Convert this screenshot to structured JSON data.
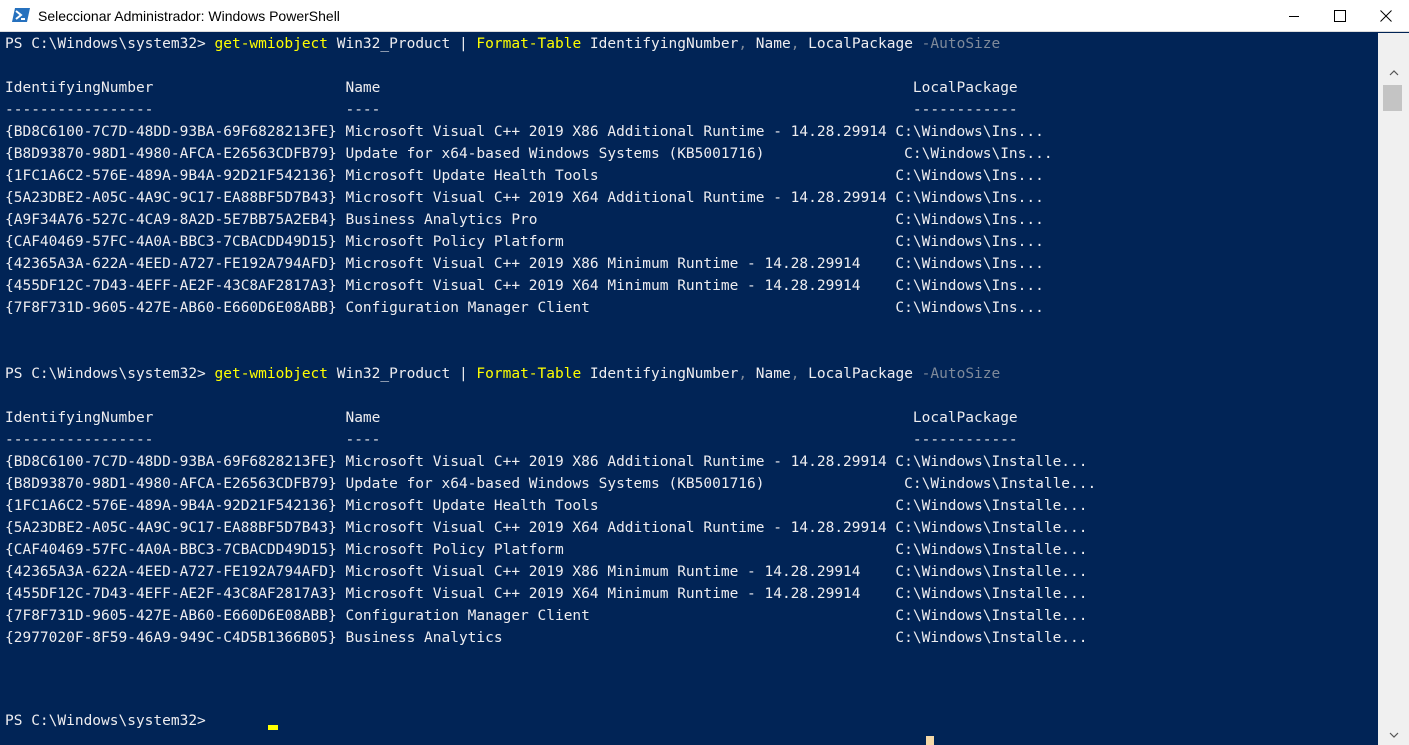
{
  "window": {
    "title": "Seleccionar Administrador: Windows PowerShell",
    "app_icon": "powershell-icon",
    "controls": {
      "minimize": "minimize-icon",
      "maximize": "maximize-icon",
      "close": "close-icon"
    }
  },
  "colors": {
    "console_background": "#012456",
    "console_text": "#EEEDF0",
    "command_highlight": "#FFFF00",
    "parameter_text": "#7F8A9A"
  },
  "console": {
    "cmd1": {
      "prompt": "PS C:\\Windows\\system32> ",
      "cmdlet": "get-wmiobject",
      "arg1": " Win32_Product | ",
      "cmdlet2": "Format-Table",
      "args": " IdentifyingNumber",
      "sep1": ",",
      "arg3": " Name",
      "sep2": ",",
      "arg4": " LocalPackage ",
      "param": "-AutoSize"
    },
    "table1": {
      "header": "IdentifyingNumber                      Name                                                             LocalPackage",
      "underline": "-----------------                      ----                                                             ------------",
      "rows": [
        "{BD8C6100-7C7D-48DD-93BA-69F6828213FE} Microsoft Visual C++ 2019 X86 Additional Runtime - 14.28.29914 C:\\Windows\\Ins...",
        "{B8D93870-98D1-4980-AFCA-E26563CDFB79} Update for x64-based Windows Systems (KB5001716)                C:\\Windows\\Ins...",
        "{1FC1A6C2-576E-489A-9B4A-92D21F542136} Microsoft Update Health Tools                                  C:\\Windows\\Ins...",
        "{5A23DBE2-A05C-4A9C-9C17-EA88BF5D7B43} Microsoft Visual C++ 2019 X64 Additional Runtime - 14.28.29914 C:\\Windows\\Ins...",
        "{A9F34A76-527C-4CA9-8A2D-5E7BB75A2EB4} Business Analytics Pro                                         C:\\Windows\\Ins...",
        "{CAF40469-57FC-4A0A-BBC3-7CBACDD49D15} Microsoft Policy Platform                                      C:\\Windows\\Ins...",
        "{42365A3A-622A-4EED-A727-FE192A794AFD} Microsoft Visual C++ 2019 X86 Minimum Runtime - 14.28.29914    C:\\Windows\\Ins...",
        "{455DF12C-7D43-4EFF-AE2F-43C8AF2817A3} Microsoft Visual C++ 2019 X64 Minimum Runtime - 14.28.29914    C:\\Windows\\Ins...",
        "{7F8F731D-9605-427E-AB60-E660D6E08ABB} Configuration Manager Client                                   C:\\Windows\\Ins..."
      ]
    },
    "table2": {
      "header": "IdentifyingNumber                      Name                                                             LocalPackage",
      "underline": "-----------------                      ----                                                             ------------",
      "rows": [
        "{BD8C6100-7C7D-48DD-93BA-69F6828213FE} Microsoft Visual C++ 2019 X86 Additional Runtime - 14.28.29914 C:\\Windows\\Installe...",
        "{B8D93870-98D1-4980-AFCA-E26563CDFB79} Update for x64-based Windows Systems (KB5001716)                C:\\Windows\\Installe...",
        "{1FC1A6C2-576E-489A-9B4A-92D21F542136} Microsoft Update Health Tools                                  C:\\Windows\\Installe...",
        "{5A23DBE2-A05C-4A9C-9C17-EA88BF5D7B43} Microsoft Visual C++ 2019 X64 Additional Runtime - 14.28.29914 C:\\Windows\\Installe...",
        "{CAF40469-57FC-4A0A-BBC3-7CBACDD49D15} Microsoft Policy Platform                                      C:\\Windows\\Installe...",
        "{42365A3A-622A-4EED-A727-FE192A794AFD} Microsoft Visual C++ 2019 X86 Minimum Runtime - 14.28.29914    C:\\Windows\\Installe...",
        "{455DF12C-7D43-4EFF-AE2F-43C8AF2817A3} Microsoft Visual C++ 2019 X64 Minimum Runtime - 14.28.29914    C:\\Windows\\Installe...",
        "{7F8F731D-9605-427E-AB60-E660D6E08ABB} Configuration Manager Client                                   C:\\Windows\\Installe...",
        "{2977020F-8F59-46A9-949C-C4D5B1366B05} Business Analytics                                             C:\\Windows\\Installe..."
      ]
    },
    "final_prompt": "PS C:\\Windows\\system32> "
  },
  "scrollbar": {
    "up_icon": "scroll-up-arrow-icon",
    "down_icon": "scroll-down-arrow-icon"
  }
}
